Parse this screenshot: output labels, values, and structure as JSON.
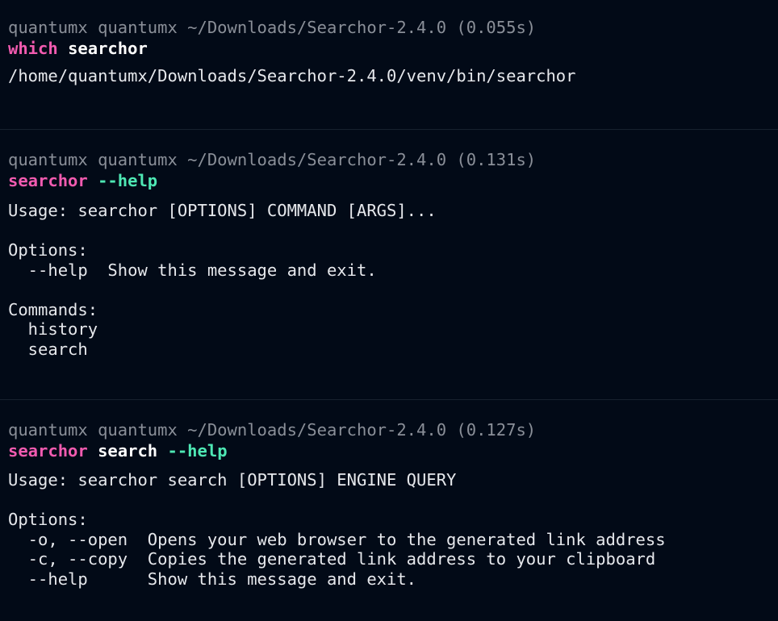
{
  "blocks": [
    {
      "prompt": "quantumx quantumx ~/Downloads/Searchor-2.4.0 (0.055s)",
      "command": {
        "program": "which",
        "args": "searchor",
        "flags": ""
      },
      "output": "/home/quantumx/Downloads/Searchor-2.4.0/venv/bin/searchor"
    },
    {
      "prompt": "quantumx quantumx ~/Downloads/Searchor-2.4.0 (0.131s)",
      "command": {
        "program": "searchor",
        "args": "",
        "flags": "--help"
      },
      "output": "Usage: searchor [OPTIONS] COMMAND [ARGS]...\n\nOptions:\n  --help  Show this message and exit.\n\nCommands:\n  history\n  search"
    },
    {
      "prompt": "quantumx quantumx ~/Downloads/Searchor-2.4.0 (0.127s)",
      "command": {
        "program": "searchor",
        "args": "search",
        "flags": "--help"
      },
      "output": "Usage: searchor search [OPTIONS] ENGINE QUERY\n\nOptions:\n  -o, --open  Opens your web browser to the generated link address\n  -c, --copy  Copies the generated link address to your clipboard\n  --help      Show this message and exit."
    }
  ],
  "colors": {
    "background": "#020a17",
    "prompt": "#8a8f98",
    "program": "#f25bb0",
    "argument": "#ffffff",
    "flag": "#4ee8b4",
    "output": "#e6e8ec",
    "divider": "#17212e"
  }
}
